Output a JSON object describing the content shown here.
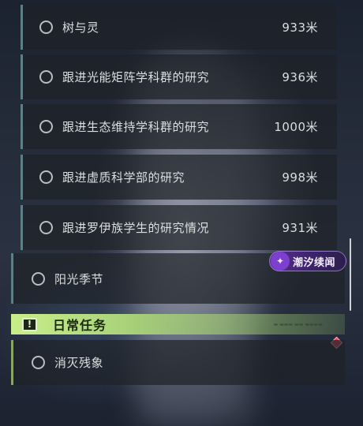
{
  "quests": {
    "sub_items": [
      {
        "name": "树与灵",
        "distance": "933米"
      },
      {
        "name": "跟进光能矩阵学科群的研究",
        "distance": "936米"
      },
      {
        "name": "跟进生态维持学科群的研究",
        "distance": "1000米"
      },
      {
        "name": "跟进虚质科学部的研究",
        "distance": "998米"
      },
      {
        "name": "跟进罗伊族学生的研究情况",
        "distance": "931米"
      }
    ],
    "main_item": {
      "name": "阳光季节"
    }
  },
  "daily": {
    "header_icon": "alert-icon",
    "header_icon_glyph": "!",
    "title": "日常任务",
    "items": [
      {
        "name": "消灭残象"
      }
    ]
  },
  "watermark": {
    "text": "潮汐续闻",
    "icon": "watermark-logo-icon"
  },
  "colors": {
    "daily_accent": "#c8ee8a",
    "quest_bar": "#5e7f86",
    "tracker_marker": "#e0465a",
    "watermark_bg": "#5a2d8f"
  }
}
